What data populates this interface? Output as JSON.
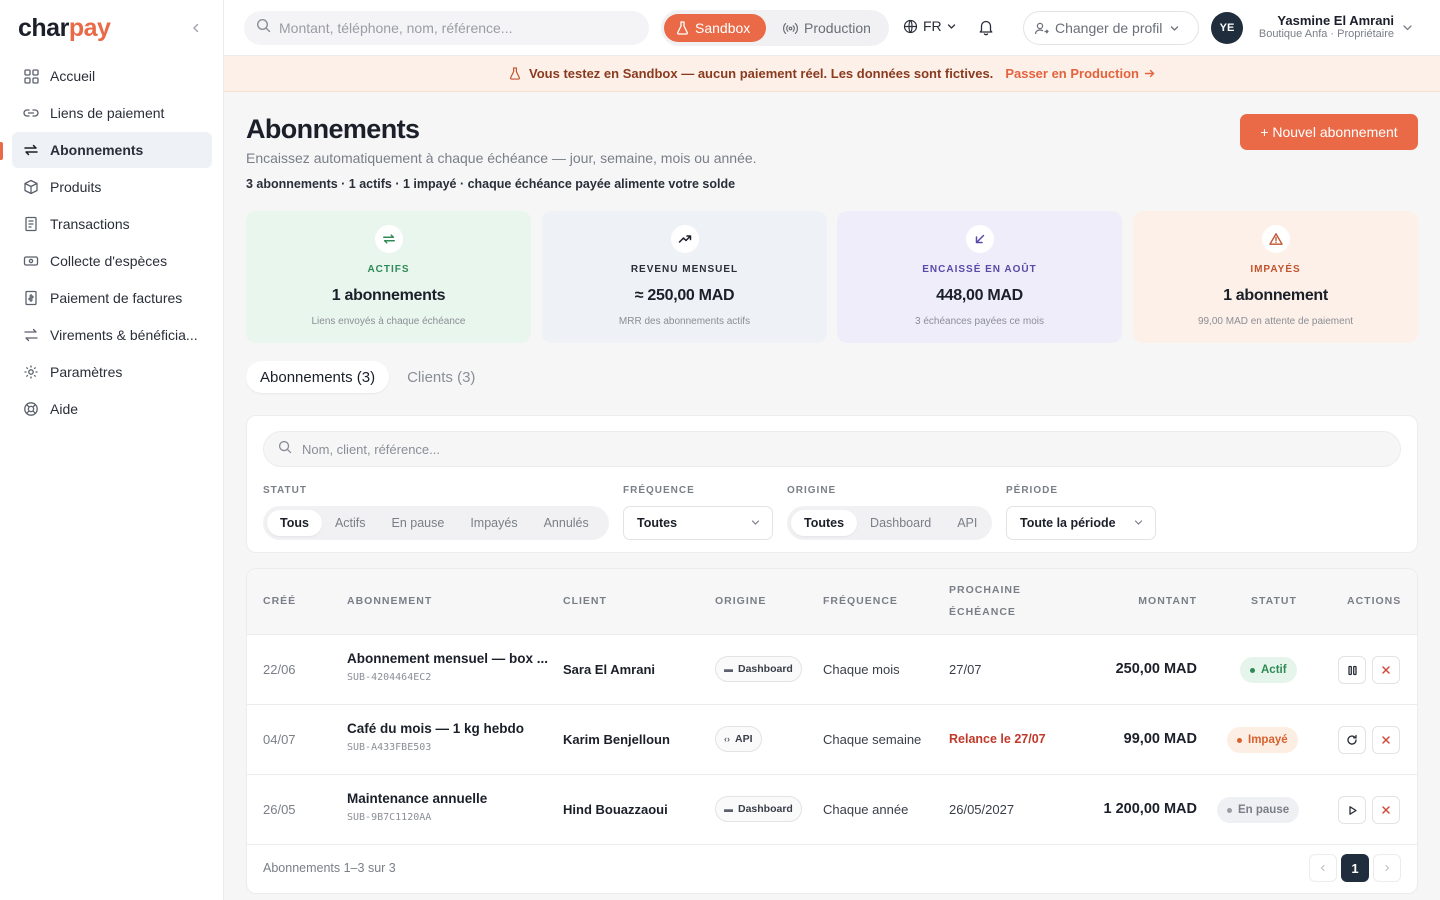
{
  "brand": {
    "part1": "char",
    "part2": "pay",
    "accent": "#ea6a47"
  },
  "sidebar": {
    "items": [
      {
        "label": "Accueil",
        "icon": "grid-icon"
      },
      {
        "label": "Liens de paiement",
        "icon": "link-icon"
      },
      {
        "label": "Abonnements",
        "icon": "repeat-icon",
        "active": true
      },
      {
        "label": "Produits",
        "icon": "box-icon"
      },
      {
        "label": "Transactions",
        "icon": "receipt-icon"
      },
      {
        "label": "Collecte d'espèces",
        "icon": "cash-icon"
      },
      {
        "label": "Paiement de factures",
        "icon": "invoice-icon"
      },
      {
        "label": "Virements & bénéficia...",
        "icon": "transfer-icon"
      },
      {
        "label": "Paramètres",
        "icon": "gear-icon"
      },
      {
        "label": "Aide",
        "icon": "help-icon"
      }
    ]
  },
  "topbar": {
    "search_placeholder": "Montant, téléphone, nom, référence...",
    "env_sandbox": "Sandbox",
    "env_production": "Production",
    "lang": "FR",
    "profile_switch": "Changer de profil",
    "avatar_initials": "YE",
    "user_name": "Yasmine El Amrani",
    "user_role": "Boutique Anfa · Propriétaire"
  },
  "banner": {
    "message": "Vous testez en Sandbox — aucun paiement réel. Les données sont fictives.",
    "link": "Passer en Production"
  },
  "page": {
    "title": "Abonnements",
    "subtitle": "Encaissez automatiquement à chaque échéance — jour, semaine, mois ou année.",
    "stats": "3 abonnements · 1 actifs · 1 impayé · chaque échéance payée alimente votre solde",
    "new_button": "+ Nouvel abonnement"
  },
  "kpis": [
    {
      "label": "ACTIFS",
      "value": "1 abonnements",
      "note": "Liens envoyés à chaque échéance",
      "icon": "repeat-icon"
    },
    {
      "label": "REVENU MENSUEL",
      "value": "≈ 250,00 MAD",
      "note": "MRR des abonnements actifs",
      "icon": "trend-up-icon"
    },
    {
      "label": "ENCAISSÉ EN AOÛT",
      "value": "448,00 MAD",
      "note": "3 échéances payées ce mois",
      "icon": "arrow-down-left-icon"
    },
    {
      "label": "IMPAYÉS",
      "value": "1 abonnement",
      "note": "99,00 MAD en attente de paiement",
      "icon": "warning-icon"
    }
  ],
  "tabs": [
    {
      "label": "Abonnements (3)",
      "active": true
    },
    {
      "label": "Clients (3)",
      "active": false
    }
  ],
  "filters": {
    "search_placeholder": "Nom, client, référence...",
    "status_label": "STATUT",
    "status_options": [
      "Tous",
      "Actifs",
      "En pause",
      "Impayés",
      "Annulés"
    ],
    "status_selected": "Tous",
    "frequency_label": "FRÉQUENCE",
    "frequency_value": "Toutes",
    "origin_label": "ORIGINE",
    "origin_options": [
      "Toutes",
      "Dashboard",
      "API"
    ],
    "origin_selected": "Toutes",
    "period_label": "PÉRIODE",
    "period_value": "Toute la période"
  },
  "table": {
    "headers": {
      "created": "CRÉÉ",
      "subscription": "ABONNEMENT",
      "client": "CLIENT",
      "origin": "ORIGINE",
      "frequency": "FRÉQUENCE",
      "next_due_1": "PROCHAINE",
      "next_due_2": "ÉCHÉANCE",
      "amount": "MONTANT",
      "status": "STATUT",
      "actions": "ACTIONS"
    },
    "rows": [
      {
        "created": "22/06",
        "name": "Abonnement mensuel — box ...",
        "ref": "SUB-4204464EC2",
        "client": "Sara El Amrani",
        "origin": "Dashboard",
        "frequency": "Chaque mois",
        "next": "27/07",
        "amount": "250,00 MAD",
        "status": "Actif"
      },
      {
        "created": "04/07",
        "name": "Café du mois — 1 kg hebdo",
        "ref": "SUB-A433FBE503",
        "client": "Karim Benjelloun",
        "origin": "API",
        "frequency": "Chaque semaine",
        "next": "Relance le 27/07",
        "amount": "99,00 MAD",
        "status": "Impayé"
      },
      {
        "created": "26/05",
        "name": "Maintenance annuelle",
        "ref": "SUB-9B7C1120AA",
        "client": "Hind Bouazzaoui",
        "origin": "Dashboard",
        "frequency": "Chaque année",
        "next": "26/05/2027",
        "amount": "1 200,00 MAD",
        "status": "En pause"
      }
    ],
    "footer": "Abonnements 1–3 sur 3",
    "page_current": "1"
  }
}
